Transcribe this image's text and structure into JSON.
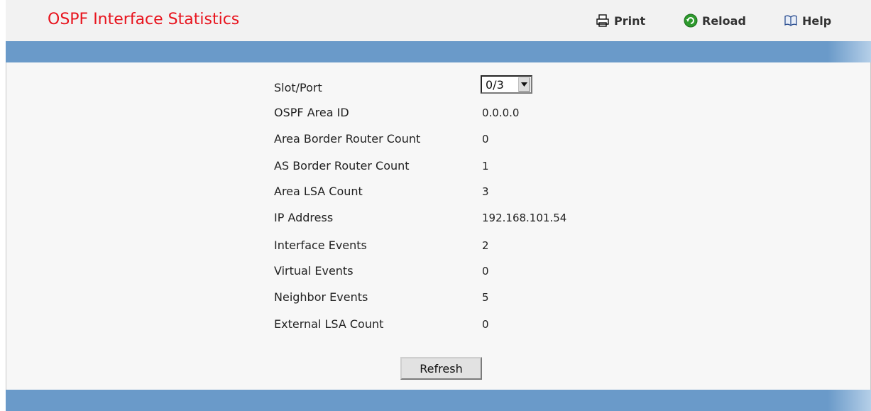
{
  "header": {
    "title": "OSPF Interface Statistics",
    "print_label": "Print",
    "reload_label": "Reload",
    "help_label": "Help",
    "print_icon": "printer-icon",
    "reload_icon": "reload-icon",
    "help_icon": "book-icon"
  },
  "colors": {
    "title": "#e8141e",
    "bar": "#6a9ac9",
    "panel": "#f7f7f7"
  },
  "form": {
    "slot_port": {
      "label": "Slot/Port",
      "selected": "0/3"
    },
    "fields": [
      {
        "label": "OSPF Area ID",
        "value": "0.0.0.0"
      },
      {
        "label": "Area Border Router Count",
        "value": "0"
      },
      {
        "label": "AS Border Router Count",
        "value": "1"
      },
      {
        "label": "Area LSA Count",
        "value": "3"
      },
      {
        "label": "IP Address",
        "value": "192.168.101.54"
      },
      {
        "label": "Interface Events",
        "value": "2"
      },
      {
        "label": "Virtual Events",
        "value": "0"
      },
      {
        "label": "Neighbor Events",
        "value": "5"
      },
      {
        "label": "External LSA Count",
        "value": "0"
      }
    ],
    "refresh_label": "Refresh"
  }
}
